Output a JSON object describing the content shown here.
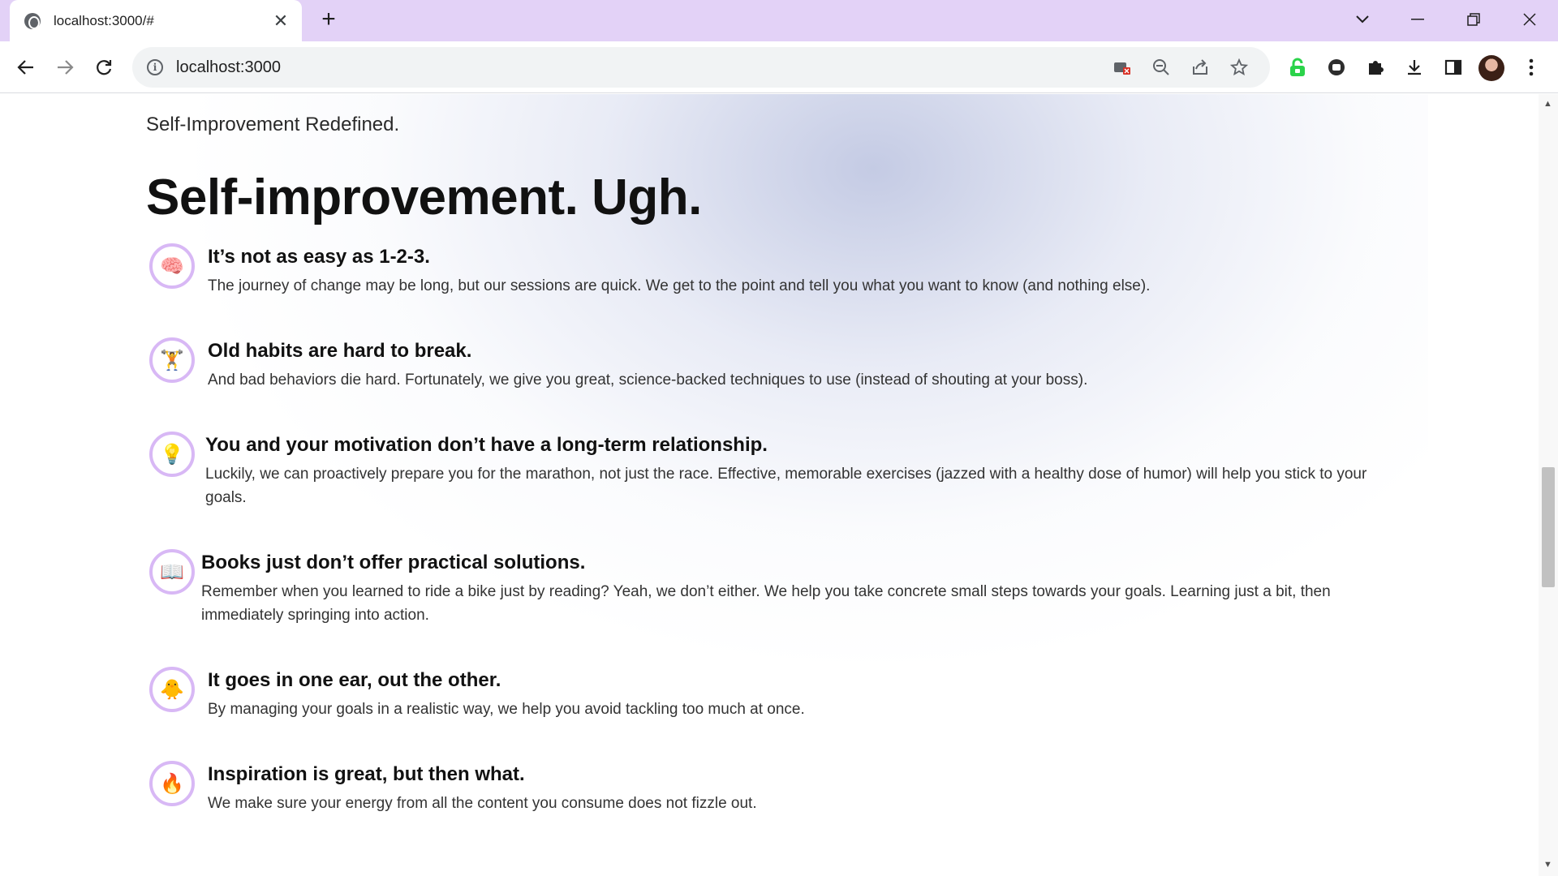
{
  "browser": {
    "tab": {
      "title": "localhost:3000/#",
      "close": "✕"
    },
    "new_tab": "+",
    "window_controls": {
      "dropdown": "⌄",
      "minimize": "—",
      "restore": "❐",
      "close": "✕"
    },
    "nav": {
      "back": "←",
      "forward": "→",
      "reload": "↻"
    },
    "address": {
      "info": "i",
      "url": "localhost:3000"
    },
    "icons": [
      "camera-off-icon",
      "zoom-icon",
      "share-icon",
      "bookmark-star-icon",
      "lock-extension-icon",
      "media-extension-icon",
      "extensions-puzzle-icon",
      "download-icon",
      "side-panel-icon",
      "profile-avatar",
      "menu-icon"
    ]
  },
  "page": {
    "tagline": "Self-Improvement Redefined.",
    "headline": "Self-improvement. Ugh.",
    "items": [
      {
        "icon": "🧠",
        "icon_name": "brain-icon",
        "title": "It’s not as easy as 1-2-3.",
        "desc": "The journey of change may be long, but our sessions are quick. We get to the point and tell you what you want to know (and nothing else)."
      },
      {
        "icon": "🏋",
        "icon_name": "weightlifter-icon",
        "title": "Old habits are hard to break.",
        "desc": "And bad behaviors die hard. Fortunately, we give you great, science-backed techniques to use (instead of shouting at your boss)."
      },
      {
        "icon": "💡",
        "icon_name": "lightbulb-icon",
        "title": "You and your motivation don’t have a long-term relationship.",
        "desc": "Luckily, we can proactively prepare you for the marathon, not just the race. Effective, memorable exercises (jazzed with a healthy dose of humor) will help you stick to your goals."
      },
      {
        "icon": "📖",
        "icon_name": "open-book-icon",
        "title": "Books just don’t offer practical solutions.",
        "desc": "Remember when you learned to ride a bike just by reading? Yeah, we don’t either. We help you take concrete small steps towards your goals. Learning just a bit, then immediately springing into action."
      },
      {
        "icon": "🐥",
        "icon_name": "chick-icon",
        "title": "It goes in one ear, out the other.",
        "desc": "By managing your goals in a realistic way, we help you avoid tackling too much at once."
      },
      {
        "icon": "🔥",
        "icon_name": "fire-icon",
        "title": "Inspiration is great, but then what.",
        "desc": "We make sure your energy from all the content you consume does not fizzle out."
      }
    ]
  },
  "colors": {
    "tabstrip": "#e3d2f7",
    "icon_ring": "#d8b8f5",
    "heading": "#111111"
  }
}
